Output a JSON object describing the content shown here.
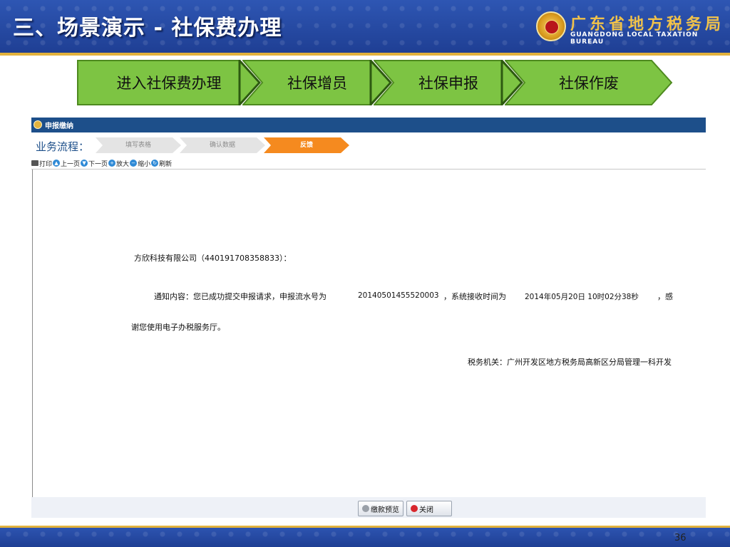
{
  "slide": {
    "title": "三、场景演示 - 社保费办理",
    "bureau_cn": "广东省地方税务局",
    "bureau_en": "GUANGDONG LOCAL TAXATION BUREAU",
    "page_number": "36"
  },
  "steps": [
    "进入社保费办理",
    "社保增员",
    "社保申报",
    "社保作废"
  ],
  "window": {
    "title": "申报缴纳",
    "flow_label": "业务流程：",
    "flow_steps": [
      {
        "label": "填写表格",
        "active": false
      },
      {
        "label": "确认数据",
        "active": false
      },
      {
        "label": "反馈",
        "active": true
      }
    ],
    "toolbar": {
      "print": "打印",
      "prev": "上一页",
      "next": "下一页",
      "zoom_in": "放大",
      "zoom_out": "缩小",
      "refresh": "刷新"
    }
  },
  "notice": {
    "company": "方欣科技有限公司（440191708358833）：",
    "intro": "通知内容：您已成功提交申报请求，申报流水号为",
    "serial": "20140501455520003",
    "time_label": "，系统接收时间为",
    "time": "2014年05月20日  10时02分38秒",
    "tail": "，感",
    "line2": "谢您使用电子办税服务厅。",
    "authority": "税务机关：广州开发区地方税务局高新区分局管理一科开发"
  },
  "buttons": {
    "preview": "缴款预览",
    "close": "关闭"
  },
  "colors": {
    "header_blue": "#2347a6",
    "gold": "#e2b23c",
    "step_green": "#7dc443",
    "window_title": "#1d4f8a",
    "flow_active": "#f58a1f"
  }
}
